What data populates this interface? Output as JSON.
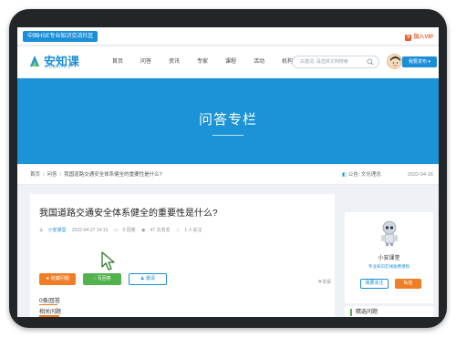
{
  "topbar": {
    "community": "中国HSE专业知识交流社区",
    "vip": "加入VIP"
  },
  "logo": {
    "name": "安知课",
    "sub": "ANZHIKE"
  },
  "nav": [
    "首页",
    "问答",
    "资讯",
    "专家",
    "课程",
    "活动",
    "机构"
  ],
  "search": {
    "placeholder": "关键词, 请选择文档搜索"
  },
  "publish_label": "我要发布 ▾",
  "banner": {
    "title": "问答专栏"
  },
  "breadcrumb": {
    "home": "首页",
    "qa": "问答",
    "current": "我国道路交通安全体系健全的重要性是什么?"
  },
  "notice": {
    "text": "公告: 文化理念",
    "date": "2022-04-16"
  },
  "question": {
    "title": "我国道路交通安全体系健全的重要性是什么?",
    "author": "小安课堂",
    "time": "2022-04-27 14:10",
    "answers": "0 回答",
    "views": "47 次浏览",
    "follows": "1 人关注"
  },
  "actions": {
    "collect": "收藏问题",
    "answer": "写回答",
    "invite": "邀请",
    "report": "举报"
  },
  "answer_count": "0条回答",
  "related": "相关问题",
  "sidebar": {
    "name": "小安课堂",
    "desc": "专业知识在线收费课程",
    "follow": "我要关注",
    "message": "私信"
  },
  "featured": "精选问题",
  "colors": {
    "brand": "#1a8fd8",
    "orange": "#f07e26",
    "green": "#52b34d"
  }
}
